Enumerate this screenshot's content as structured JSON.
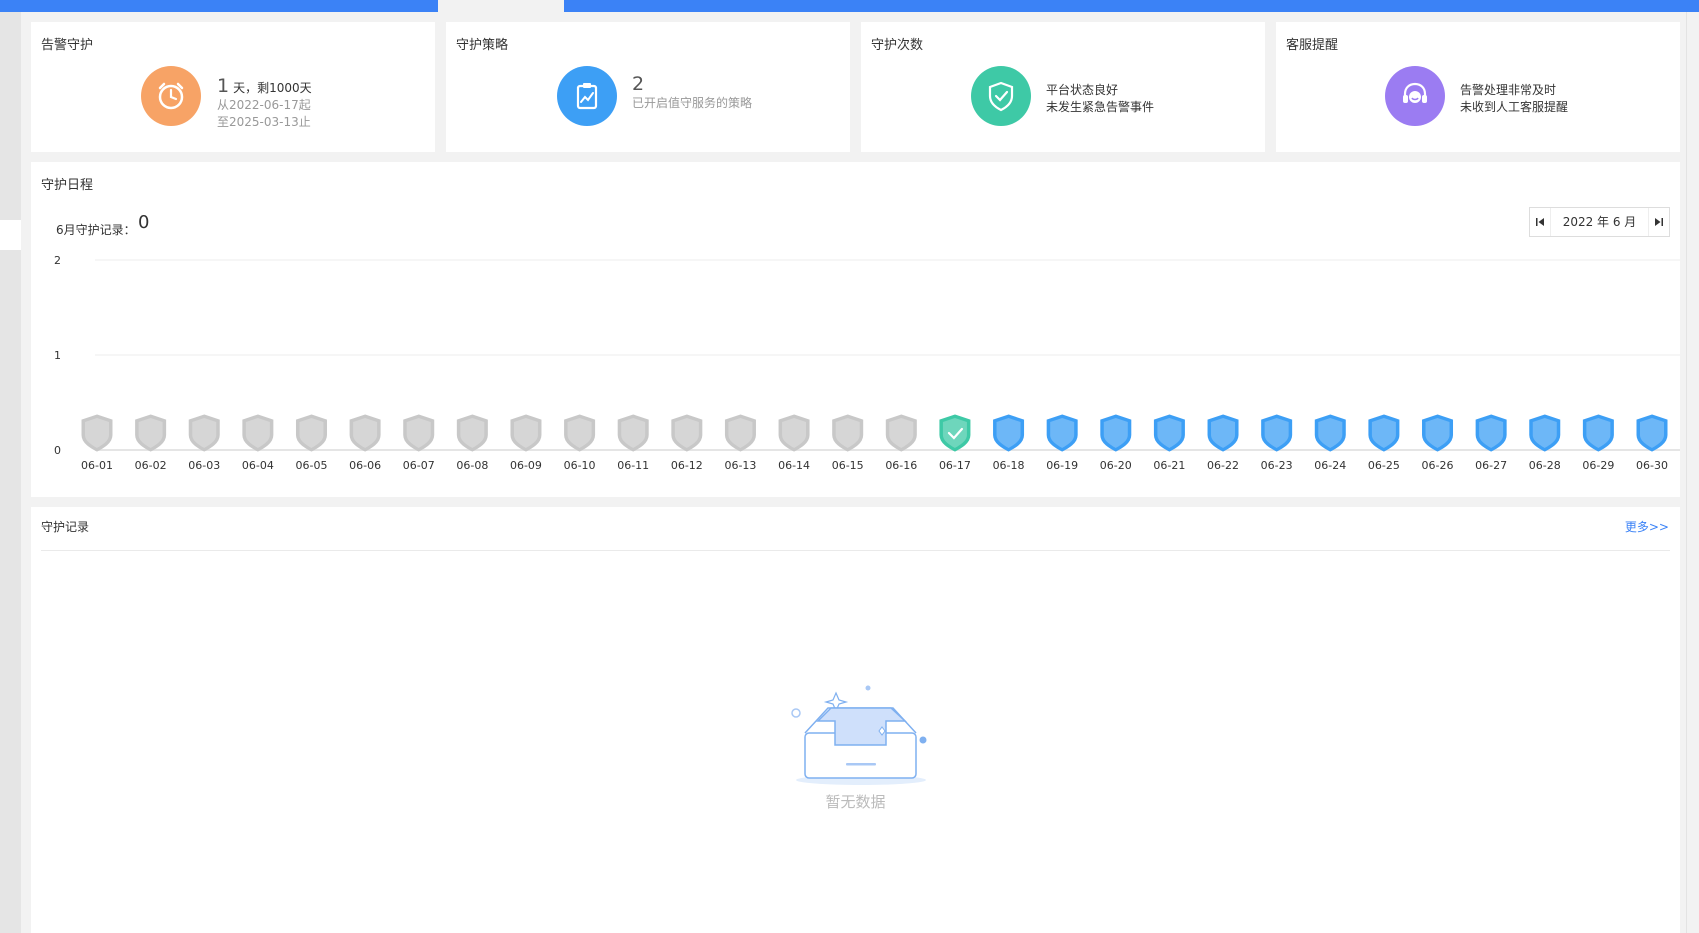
{
  "stats": [
    {
      "title": "告警守护",
      "main_value": "1",
      "main_suffix": "天，剩1000天",
      "line2": "从2022-06-17起",
      "line3": "至2025-03-13止",
      "icon": "alarm-clock-icon",
      "color": "#f7a366"
    },
    {
      "title": "守护策略",
      "main_value": "2",
      "main_suffix": "",
      "line2": "已开启值守服务的策略",
      "line3": "",
      "icon": "clipboard-chart-icon",
      "color": "#3d9ff5"
    },
    {
      "title": "守护次数",
      "main_value": "",
      "main_suffix": "",
      "line2": "平台状态良好",
      "line3": "未发生紧急告警事件",
      "icon": "shield-check-icon",
      "color": "#3ec9a6"
    },
    {
      "title": "客服提醒",
      "main_value": "",
      "main_suffix": "",
      "line2": "告警处理非常及时",
      "line3": "未收到人工客服提醒",
      "icon": "support-headset-icon",
      "color": "#9b7cf2"
    }
  ],
  "schedule": {
    "title": "守护日程",
    "count_label": "6月守护记录：",
    "count_value": "0",
    "month_label": "2022 年 6 月",
    "prev_icon": "first-page-icon",
    "next_icon": "last-page-icon",
    "colors": {
      "past": "#c8c8c8",
      "today": "#3ec9a6",
      "future": "#3d9ff5"
    }
  },
  "chart_data": {
    "type": "scatter",
    "x": [
      "06-01",
      "06-02",
      "06-03",
      "06-04",
      "06-05",
      "06-06",
      "06-07",
      "06-08",
      "06-09",
      "06-10",
      "06-11",
      "06-12",
      "06-13",
      "06-14",
      "06-15",
      "06-16",
      "06-17",
      "06-18",
      "06-19",
      "06-20",
      "06-21",
      "06-22",
      "06-23",
      "06-24",
      "06-25",
      "06-26",
      "06-27",
      "06-28",
      "06-29",
      "06-30"
    ],
    "values": [
      0,
      0,
      0,
      0,
      0,
      0,
      0,
      0,
      0,
      0,
      0,
      0,
      0,
      0,
      0,
      0,
      0,
      0,
      0,
      0,
      0,
      0,
      0,
      0,
      0,
      0,
      0,
      0,
      0,
      0
    ],
    "status": [
      "past",
      "past",
      "past",
      "past",
      "past",
      "past",
      "past",
      "past",
      "past",
      "past",
      "past",
      "past",
      "past",
      "past",
      "past",
      "past",
      "today",
      "future",
      "future",
      "future",
      "future",
      "future",
      "future",
      "future",
      "future",
      "future",
      "future",
      "future",
      "future",
      "future"
    ],
    "yticks": [
      "0",
      "1",
      "2"
    ],
    "ylim": [
      0,
      2
    ],
    "grid": true
  },
  "records": {
    "title": "守护记录",
    "more_label": "更多>>",
    "empty_text": "暂无数据"
  }
}
